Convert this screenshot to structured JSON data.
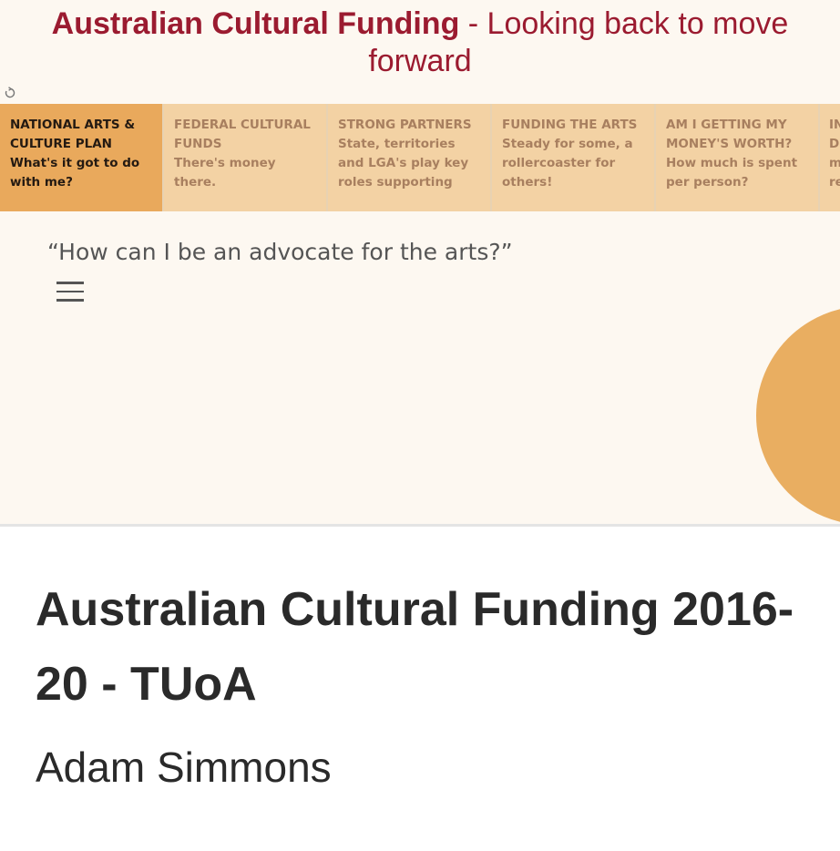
{
  "viz": {
    "title_bold": "Australian Cultural Funding",
    "title_rest": " - Looking back to move forward",
    "quote": "“How can I be an advocate for the arts?”",
    "tabs": [
      {
        "head": "NATIONAL ARTS & CULTURE PLAN",
        "sub": "What's it got to do with me?"
      },
      {
        "head": "FEDERAL CULTURAL FUNDS",
        "sub": "There's money there."
      },
      {
        "head": "STRONG PARTNERS",
        "sub": "State, territories and LGA's play key roles supporting"
      },
      {
        "head": "FUNDING THE ARTS",
        "sub": "Steady for some, a rollercoaster for others!"
      },
      {
        "head": "AM I GETTING MY MONEY'S WORTH?",
        "sub": "How much is spent per person?"
      },
      {
        "head": "IN",
        "sub": "D m re"
      }
    ]
  },
  "work": {
    "title": "Australian Cultural Funding 2016-20 - TUoA",
    "author": "Adam Simmons"
  },
  "colors": {
    "title": "#9b1b30",
    "tab_active": "#e9a95c",
    "tab": "#f3d2a4",
    "circle": "#e9ae61",
    "background": "#fdf8f1"
  }
}
